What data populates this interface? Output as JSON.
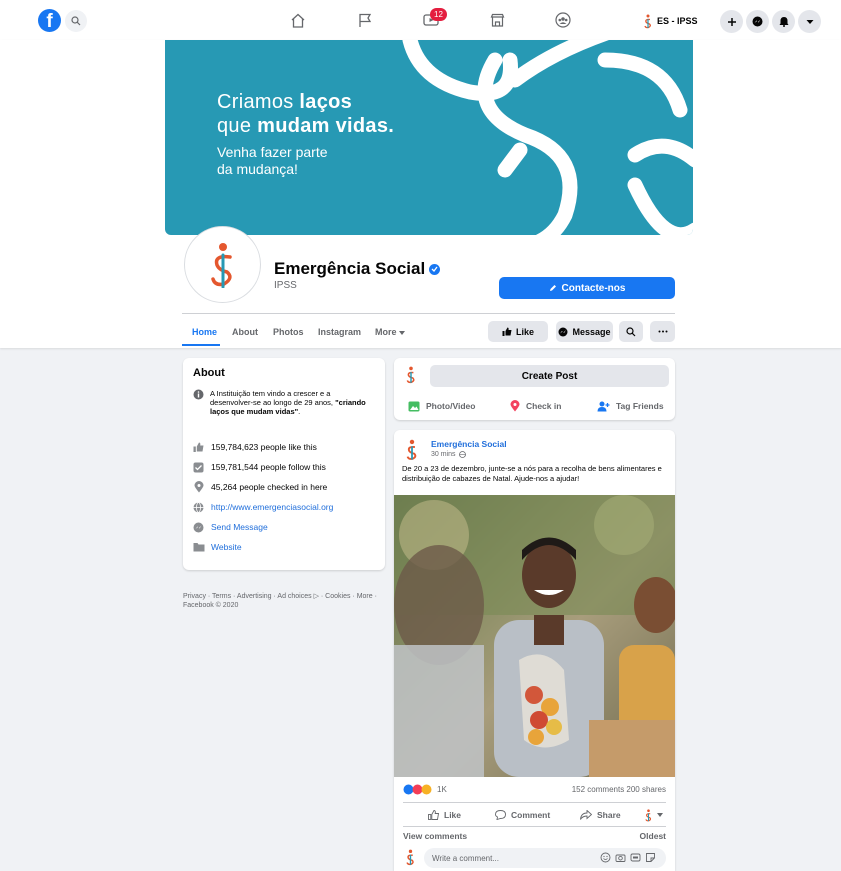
{
  "topbar": {
    "logo_letter": "f",
    "notification_count": "12",
    "profile_name": "ES - IPSS"
  },
  "cover": {
    "line1_prefix": "Criamos ",
    "line1_bold": "laços",
    "line2_prefix": "que ",
    "line2_bold": "mudam vidas.",
    "sub1": "Venha fazer parte",
    "sub2": "da mudança!",
    "bg_color": "#2799b4"
  },
  "page": {
    "name": "Emergência Social",
    "category": "IPSS",
    "contact_label": "Contacte-nos"
  },
  "tabs": [
    {
      "label": "Home"
    },
    {
      "label": "About"
    },
    {
      "label": "Photos"
    },
    {
      "label": "Instagram"
    },
    {
      "label": "More"
    }
  ],
  "actions": {
    "like": "Like",
    "message": "Message"
  },
  "about": {
    "title": "About",
    "desc_prefix": "A Instituição tem vindo a crescer e a desenvolver-se ao longo de 29 anos, ",
    "desc_bold": "\"criando laços que mudam vidas\"",
    "desc_suffix": ".",
    "rows": [
      {
        "text": "159,784,623 people like this",
        "icon": "thumbs-up-icon"
      },
      {
        "text": "159,781,544 people follow this",
        "icon": "follow-check-icon"
      },
      {
        "text": "45,264 people checked in here",
        "icon": "location-pin-icon"
      },
      {
        "text": "http://www.emergenciasocial.org",
        "icon": "globe-icon"
      },
      {
        "text": "Send Message",
        "icon": "messenger-icon"
      },
      {
        "text": "Website",
        "icon": "folder-icon"
      }
    ]
  },
  "footer": {
    "text": "Privacy · Terms · Advertising · Ad choices ▷ · Cookies · More · Facebook © 2020"
  },
  "create_post": {
    "label": "Create Post",
    "photo_video": "Photo/Video",
    "check_in": "Check in",
    "tag_friends": "Tag Friends"
  },
  "post": {
    "author": "Emergência Social",
    "time": "30 mins",
    "text": "De 20 a 23 de dezembro, junte-se a nós para a recolha de bens alimentares e distribuição de cabazes de Natal. Ajude-nos a ajudar!",
    "reactions_count": "1K",
    "comments_shares": "152 comments  200 shares",
    "like": "Like",
    "comment": "Comment",
    "share": "Share",
    "view_comments": "View comments",
    "sort": "Oldest",
    "comment_placeholder": "Write a comment..."
  }
}
